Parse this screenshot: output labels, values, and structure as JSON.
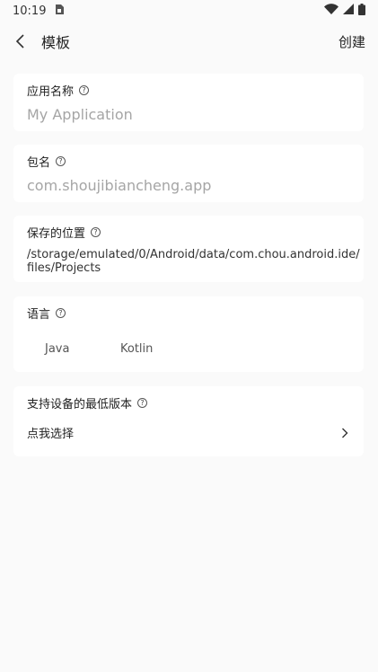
{
  "status_bar": {
    "time": "10:19",
    "sim_icon": "sim-card-icon",
    "icons": [
      "wifi-icon",
      "signal-icon",
      "battery-icon"
    ]
  },
  "app_bar": {
    "title": "模板",
    "action": "创建",
    "back_icon": "back-arrow-icon"
  },
  "fields": {
    "app_name": {
      "label": "应用名称",
      "placeholder": "My Application",
      "value": ""
    },
    "package": {
      "label": "包名",
      "placeholder": "com.shoujibiancheng.app",
      "value": ""
    },
    "save_location": {
      "label": "保存的位置",
      "path_line1": "/storage/emulated/0/Android/data/com.chou.android.ide/",
      "path_line2": "files/Projects"
    },
    "language": {
      "label": "语言",
      "options": [
        "Java",
        "Kotlin"
      ]
    },
    "min_sdk": {
      "label": "支持设备的最低版本",
      "select_text": "点我选择"
    }
  },
  "help_glyph": "?"
}
